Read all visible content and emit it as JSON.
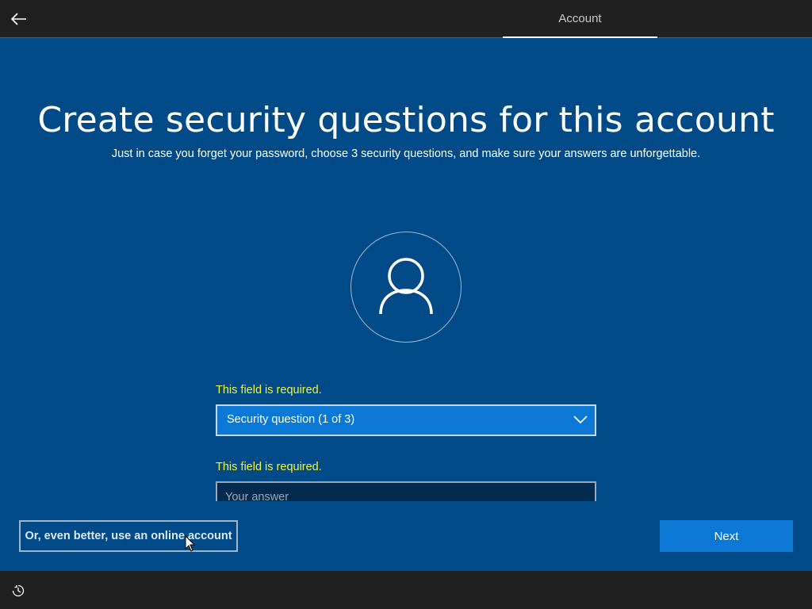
{
  "header": {
    "tab_label": "Account",
    "back_icon": "arrow-left-icon"
  },
  "main": {
    "title": "Create security questions for this account",
    "subtitle": "Just in case you forget your password, choose 3 security questions, and make sure your answers are unforgettable.",
    "avatar_icon": "user-icon",
    "question_error": "This field is required.",
    "question_selected": "Security question (1 of 3)",
    "answer_error": "This field is required.",
    "answer_placeholder": "Your answer",
    "answer_value": ""
  },
  "footer": {
    "online_account_label": "Or, even better, use an online account",
    "next_label": "Next",
    "ease_icon": "ease-of-access-icon"
  },
  "colors": {
    "main_bg": "#004b87",
    "accent": "#0a78d4",
    "error_text": "#f4f53a",
    "bar_bg": "#202020"
  }
}
